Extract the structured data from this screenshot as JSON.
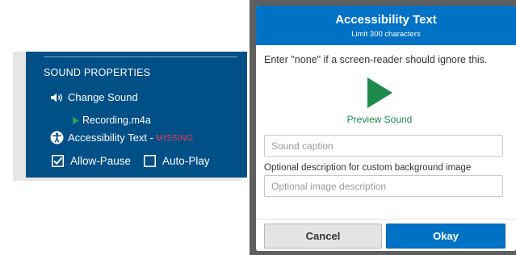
{
  "sound_panel": {
    "title": "SOUND PROPERTIES",
    "change_sound_label": "Change Sound",
    "recording_file": "Recording.m4a",
    "accessibility_label": "Accessibility Text -",
    "accessibility_status": "MISSING",
    "allow_pause": {
      "label": "Allow-Pause",
      "checked": true
    },
    "auto_play": {
      "label": "Auto-Play",
      "checked": false
    }
  },
  "dialog": {
    "title": "Accessibility Text",
    "subtitle": "Limit 300 characters",
    "instructions": "Enter \"none\" if a screen-reader should ignore this.",
    "preview_label": "Preview Sound",
    "caption_placeholder": "Sound caption",
    "description_label": "Optional description for custom background image",
    "description_placeholder": "Optional image description",
    "cancel_label": "Cancel",
    "ok_label": "Okay"
  },
  "icons": {
    "speaker": "speaker-icon",
    "play_small": "play-icon",
    "accessibility": "accessibility-icon",
    "checkbox_checked": "checkbox-checked-icon",
    "checkbox_empty": "checkbox-unchecked-icon",
    "preview_play": "play-icon"
  },
  "colors": {
    "panel_bg": "#004f86",
    "header_blue": "#0072c6",
    "missing_red": "#e8425b",
    "play_green": "#1e8a4c",
    "overlay_gray": "#5f5f5f"
  }
}
